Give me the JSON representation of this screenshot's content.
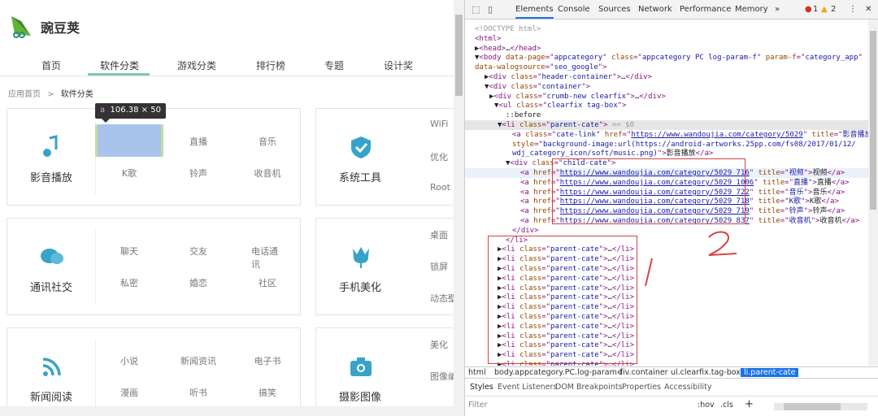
{
  "site": {
    "name": "豌豆荚"
  },
  "nav": [
    "首页",
    "软件分类",
    "游戏分类",
    "排行榜",
    "专题",
    "设计奖"
  ],
  "breadcrumb": {
    "home": "应用首页",
    "sep": ">",
    "current": "软件分类"
  },
  "tooltip": {
    "tag": "a",
    "size": "106.38 × 50"
  },
  "cards": [
    {
      "name": "影音播放",
      "subs": [
        "视频",
        "直播",
        "音乐",
        "K歌",
        "铃声",
        "收音机"
      ]
    },
    {
      "name": "系统工具",
      "subs": [
        "WiFi",
        "优化",
        "Root"
      ]
    },
    {
      "name": "通讯社交",
      "subs": [
        "聊天",
        "交友",
        "电话通讯",
        "私密",
        "婚恋",
        "社区"
      ]
    },
    {
      "name": "手机美化",
      "subs": [
        "桌面",
        "锁屏",
        "动态壁纸"
      ]
    },
    {
      "name": "新闻阅读",
      "subs": [
        "小说",
        "新闻资讯",
        "电子书",
        "漫画",
        "听书",
        "搞笑"
      ]
    },
    {
      "name": "摄影图像",
      "subs": [
        "美化",
        "图像编辑"
      ]
    }
  ],
  "devtools": {
    "tabs": [
      "Elements",
      "Console",
      "Sources",
      "Network",
      "Performance",
      "Memory",
      "»"
    ],
    "errors": "1",
    "warnings": "2",
    "lines": [
      [
        [
          "cm",
          "<!DOCTYPE html>"
        ]
      ],
      [
        [
          "tg",
          "<html>"
        ]
      ],
      [
        [
          "tx",
          "▶"
        ],
        [
          "tg",
          "<head>"
        ],
        [
          "tx",
          "…"
        ],
        [
          "tg",
          "</head>"
        ]
      ],
      [
        [
          "tx",
          "▼"
        ],
        [
          "tg",
          "<body "
        ],
        [
          "at",
          "data-page"
        ],
        [
          "tg",
          "=\""
        ],
        [
          "av",
          "appcategory"
        ],
        [
          "tg",
          "\" "
        ],
        [
          "at",
          "class"
        ],
        [
          "tg",
          "=\""
        ],
        [
          "av",
          "appcategory PC log-param-f"
        ],
        [
          "tg",
          "\" "
        ],
        [
          "at",
          "param-f"
        ],
        [
          "tg",
          "=\""
        ],
        [
          "av",
          "category_app"
        ],
        [
          "tg",
          "\""
        ]
      ],
      [
        [
          "at",
          "data-walogsource"
        ],
        [
          "tg",
          "=\""
        ],
        [
          "av",
          "seo_google"
        ],
        [
          "tg",
          "\">"
        ]
      ],
      [
        [
          "tx",
          "▶"
        ],
        [
          "tg",
          "<div "
        ],
        [
          "at",
          "class"
        ],
        [
          "tg",
          "=\""
        ],
        [
          "av",
          "header-container"
        ],
        [
          "tg",
          "\">"
        ],
        [
          "tx",
          "…"
        ],
        [
          "tg",
          "</div>"
        ]
      ],
      [
        [
          "tx",
          "▼"
        ],
        [
          "tg",
          "<div "
        ],
        [
          "at",
          "class"
        ],
        [
          "tg",
          "=\""
        ],
        [
          "av",
          "container"
        ],
        [
          "tg",
          "\">"
        ]
      ],
      [
        [
          "tx",
          "▶"
        ],
        [
          "tg",
          "<div "
        ],
        [
          "at",
          "class"
        ],
        [
          "tg",
          "=\""
        ],
        [
          "av",
          "crumb-new clearfix"
        ],
        [
          "tg",
          "\">"
        ],
        [
          "tx",
          "…"
        ],
        [
          "tg",
          "</div>"
        ]
      ],
      [
        [
          "tx",
          "▼"
        ],
        [
          "tg",
          "<ul "
        ],
        [
          "at",
          "class"
        ],
        [
          "tg",
          "=\""
        ],
        [
          "av",
          "clearfix tag-box"
        ],
        [
          "tg",
          "\">"
        ]
      ],
      [
        [
          "tx",
          "::before"
        ]
      ],
      [
        [
          "tx",
          "▼"
        ],
        [
          "tg",
          "<li "
        ],
        [
          "at",
          "class"
        ],
        [
          "tg",
          "=\""
        ],
        [
          "av",
          "parent-cate"
        ],
        [
          "tg",
          "\">"
        ],
        [
          "cm",
          " == $0"
        ]
      ],
      [
        [
          "tg",
          "<a "
        ],
        [
          "at",
          "class"
        ],
        [
          "tg",
          "=\""
        ],
        [
          "av",
          "cate-link"
        ],
        [
          "tg",
          "\" "
        ],
        [
          "at",
          "href"
        ],
        [
          "tg",
          "=\""
        ],
        [
          "lk",
          "https://www.wandoujia.com/category/5029"
        ],
        [
          "tg",
          "\" "
        ],
        [
          "at",
          "title"
        ],
        [
          "tg",
          "=\""
        ],
        [
          "av",
          "影音播放"
        ],
        [
          "tg",
          "\""
        ]
      ],
      [
        [
          "at",
          "style"
        ],
        [
          "tg",
          "=\""
        ],
        [
          "av",
          "background-image:url(https://android-artworks.25pp.com/fs08/2017/01/12/"
        ]
      ],
      [
        [
          "av",
          "wdj_category_icon/soft/music.png)"
        ],
        [
          "tg",
          "\">"
        ],
        [
          "tx",
          "影音播放"
        ],
        [
          "tg",
          "</a>"
        ]
      ],
      [
        [
          "tx",
          "▼"
        ],
        [
          "tg",
          "<div "
        ],
        [
          "at",
          "class"
        ],
        [
          "tg",
          "=\""
        ],
        [
          "av",
          "child-cate"
        ],
        [
          "tg",
          "\">"
        ]
      ],
      [
        [
          "tg",
          "<a "
        ],
        [
          "at",
          "href"
        ],
        [
          "tg",
          "=\""
        ],
        [
          "lk",
          "https://www.wandoujia.com/category/5029_716"
        ],
        [
          "tg",
          "\" "
        ],
        [
          "at",
          "title"
        ],
        [
          "tg",
          "=\""
        ],
        [
          "av",
          "视频"
        ],
        [
          "tg",
          "\">"
        ],
        [
          "tx",
          "视频"
        ],
        [
          "tg",
          "</a>"
        ]
      ],
      [
        [
          "tg",
          "<a "
        ],
        [
          "at",
          "href"
        ],
        [
          "tg",
          "=\""
        ],
        [
          "lk",
          "https://www.wandoujia.com/category/5029_1006"
        ],
        [
          "tg",
          "\" "
        ],
        [
          "at",
          "title"
        ],
        [
          "tg",
          "=\""
        ],
        [
          "av",
          "直播"
        ],
        [
          "tg",
          "\">"
        ],
        [
          "tx",
          "直播"
        ],
        [
          "tg",
          "</a>"
        ]
      ],
      [
        [
          "tg",
          "<a "
        ],
        [
          "at",
          "href"
        ],
        [
          "tg",
          "=\""
        ],
        [
          "lk",
          "https://www.wandoujia.com/category/5029_722"
        ],
        [
          "tg",
          "\" "
        ],
        [
          "at",
          "title"
        ],
        [
          "tg",
          "=\""
        ],
        [
          "av",
          "音乐"
        ],
        [
          "tg",
          "\">"
        ],
        [
          "tx",
          "音乐"
        ],
        [
          "tg",
          "</a>"
        ]
      ],
      [
        [
          "tg",
          "<a "
        ],
        [
          "at",
          "href"
        ],
        [
          "tg",
          "=\""
        ],
        [
          "lk",
          "https://www.wandoujia.com/category/5029_718"
        ],
        [
          "tg",
          "\" "
        ],
        [
          "at",
          "title"
        ],
        [
          "tg",
          "=\""
        ],
        [
          "av",
          "K歌"
        ],
        [
          "tg",
          "\">"
        ],
        [
          "tx",
          "K歌"
        ],
        [
          "tg",
          "</a>"
        ]
      ],
      [
        [
          "tg",
          "<a "
        ],
        [
          "at",
          "href"
        ],
        [
          "tg",
          "=\""
        ],
        [
          "lk",
          "https://www.wandoujia.com/category/5029_719"
        ],
        [
          "tg",
          "\" "
        ],
        [
          "at",
          "title"
        ],
        [
          "tg",
          "=\""
        ],
        [
          "av",
          "铃声"
        ],
        [
          "tg",
          "\">"
        ],
        [
          "tx",
          "铃声"
        ],
        [
          "tg",
          "</a>"
        ]
      ],
      [
        [
          "tg",
          "<a "
        ],
        [
          "at",
          "href"
        ],
        [
          "tg",
          "=\""
        ],
        [
          "lk",
          "https://www.wandoujia.com/category/5029_837"
        ],
        [
          "tg",
          "\" "
        ],
        [
          "at",
          "title"
        ],
        [
          "tg",
          "=\""
        ],
        [
          "av",
          "收音机"
        ],
        [
          "tg",
          "\">"
        ],
        [
          "tx",
          "收音机"
        ],
        [
          "tg",
          "</a>"
        ]
      ],
      [
        [
          "tg",
          "</div>"
        ]
      ],
      [
        [
          "tg",
          "</li>"
        ]
      ],
      [
        [
          "tx",
          "▶"
        ],
        [
          "tg",
          "<li "
        ],
        [
          "at",
          "class"
        ],
        [
          "tg",
          "=\""
        ],
        [
          "av",
          "parent-cate"
        ],
        [
          "tg",
          "\">"
        ],
        [
          "tx",
          "…"
        ],
        [
          "tg",
          "</li>"
        ]
      ],
      [
        [
          "tx",
          "▶"
        ],
        [
          "tg",
          "<li "
        ],
        [
          "at",
          "class"
        ],
        [
          "tg",
          "=\""
        ],
        [
          "av",
          "parent-cate"
        ],
        [
          "tg",
          "\">"
        ],
        [
          "tx",
          "…"
        ],
        [
          "tg",
          "</li>"
        ]
      ],
      [
        [
          "tx",
          "▶"
        ],
        [
          "tg",
          "<li "
        ],
        [
          "at",
          "class"
        ],
        [
          "tg",
          "=\""
        ],
        [
          "av",
          "parent-cate"
        ],
        [
          "tg",
          "\">"
        ],
        [
          "tx",
          "…"
        ],
        [
          "tg",
          "</li>"
        ]
      ],
      [
        [
          "tx",
          "▶"
        ],
        [
          "tg",
          "<li "
        ],
        [
          "at",
          "class"
        ],
        [
          "tg",
          "=\""
        ],
        [
          "av",
          "parent-cate"
        ],
        [
          "tg",
          "\">"
        ],
        [
          "tx",
          "…"
        ],
        [
          "tg",
          "</li>"
        ]
      ],
      [
        [
          "tx",
          "▶"
        ],
        [
          "tg",
          "<li "
        ],
        [
          "at",
          "class"
        ],
        [
          "tg",
          "=\""
        ],
        [
          "av",
          "parent-cate"
        ],
        [
          "tg",
          "\">"
        ],
        [
          "tx",
          "…"
        ],
        [
          "tg",
          "</li>"
        ]
      ],
      [
        [
          "tx",
          "▶"
        ],
        [
          "tg",
          "<li "
        ],
        [
          "at",
          "class"
        ],
        [
          "tg",
          "=\""
        ],
        [
          "av",
          "parent-cate"
        ],
        [
          "tg",
          "\">"
        ],
        [
          "tx",
          "…"
        ],
        [
          "tg",
          "</li>"
        ]
      ],
      [
        [
          "tx",
          "▶"
        ],
        [
          "tg",
          "<li "
        ],
        [
          "at",
          "class"
        ],
        [
          "tg",
          "=\""
        ],
        [
          "av",
          "parent-cate"
        ],
        [
          "tg",
          "\">"
        ],
        [
          "tx",
          "…"
        ],
        [
          "tg",
          "</li>"
        ]
      ],
      [
        [
          "tx",
          "▶"
        ],
        [
          "tg",
          "<li "
        ],
        [
          "at",
          "class"
        ],
        [
          "tg",
          "=\""
        ],
        [
          "av",
          "parent-cate"
        ],
        [
          "tg",
          "\">"
        ],
        [
          "tx",
          "…"
        ],
        [
          "tg",
          "</li>"
        ]
      ],
      [
        [
          "tx",
          "▶"
        ],
        [
          "tg",
          "<li "
        ],
        [
          "at",
          "class"
        ],
        [
          "tg",
          "=\""
        ],
        [
          "av",
          "parent-cate"
        ],
        [
          "tg",
          "\">"
        ],
        [
          "tx",
          "…"
        ],
        [
          "tg",
          "</li>"
        ]
      ],
      [
        [
          "tx",
          "▶"
        ],
        [
          "tg",
          "<li "
        ],
        [
          "at",
          "class"
        ],
        [
          "tg",
          "=\""
        ],
        [
          "av",
          "parent-cate"
        ],
        [
          "tg",
          "\">"
        ],
        [
          "tx",
          "…"
        ],
        [
          "tg",
          "</li>"
        ]
      ],
      [
        [
          "tx",
          "▶"
        ],
        [
          "tg",
          "<li "
        ],
        [
          "at",
          "class"
        ],
        [
          "tg",
          "=\""
        ],
        [
          "av",
          "parent-cate"
        ],
        [
          "tg",
          "\">"
        ],
        [
          "tx",
          "…"
        ],
        [
          "tg",
          "</li>"
        ]
      ],
      [
        [
          "tx",
          "▶"
        ],
        [
          "tg",
          "<li "
        ],
        [
          "at",
          "class"
        ],
        [
          "tg",
          "=\""
        ],
        [
          "av",
          "parent-cate"
        ],
        [
          "tg",
          "\">"
        ],
        [
          "tx",
          "…"
        ],
        [
          "tg",
          "</li>"
        ]
      ],
      [
        [
          "tx",
          "▶"
        ],
        [
          "tg",
          "<li "
        ],
        [
          "at",
          "class"
        ],
        [
          "tg",
          "=\""
        ],
        [
          "av",
          "parent-cate"
        ],
        [
          "tg",
          "\">"
        ],
        [
          "tx",
          "…"
        ],
        [
          "tg",
          "</li>"
        ]
      ]
    ],
    "breadcrumbs": [
      "html",
      "body.appcategory.PC.log-param-f",
      "div.container",
      "ul.clearfix.tag-box",
      "li.parent-cate"
    ],
    "subtabs": [
      "Styles",
      "Event Listeners",
      "DOM Breakpoints",
      "Properties",
      "Accessibility"
    ],
    "filter_placeholder": "Filter",
    "hov": ":hov",
    "cls": ".cls",
    "plus": "+"
  },
  "annotations": {
    "one": "1",
    "two": "2"
  },
  "colors": {
    "accent": "#7ec9b4",
    "icon": "#38a3c8",
    "devtools_blue": "#1a73e8",
    "annotation_red": "#d94040"
  }
}
